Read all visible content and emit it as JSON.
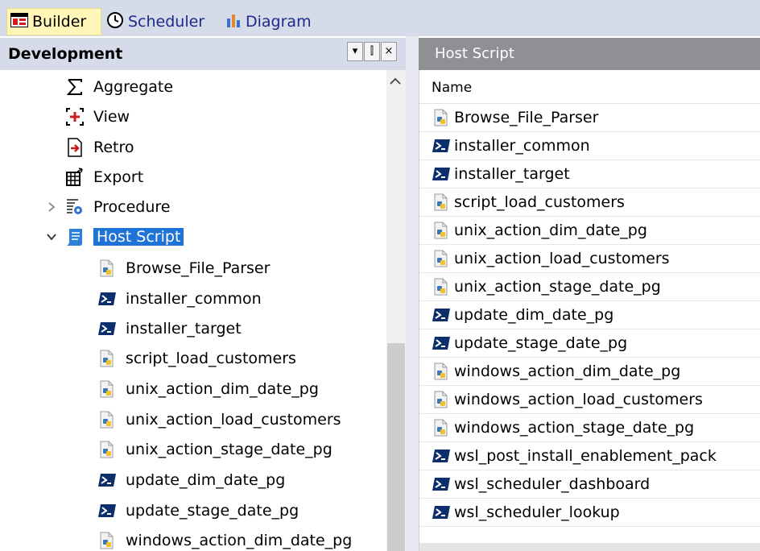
{
  "tabs": [
    {
      "label": "Builder",
      "icon": "builder-icon",
      "active": true
    },
    {
      "label": "Scheduler",
      "icon": "clock-icon",
      "active": false
    },
    {
      "label": "Diagram",
      "icon": "bar-chart-icon",
      "active": false
    }
  ],
  "left_panel": {
    "title": "Development",
    "buttons": {
      "dropdown": "▾",
      "pin": "⫿",
      "close": "×"
    },
    "tree": [
      {
        "label": "Aggregate",
        "icon": "sigma-icon"
      },
      {
        "label": "View",
        "icon": "view-plus-icon"
      },
      {
        "label": "Retro",
        "icon": "retro-icon"
      },
      {
        "label": "Export",
        "icon": "export-grid-icon"
      },
      {
        "label": "Procedure",
        "icon": "procedure-icon"
      },
      {
        "label": "Host Script",
        "icon": "scroll-icon"
      }
    ],
    "children": [
      {
        "label": "Browse_File_Parser",
        "icon": "python-script-icon"
      },
      {
        "label": "installer_common",
        "icon": "powershell-icon"
      },
      {
        "label": "installer_target",
        "icon": "powershell-icon"
      },
      {
        "label": "script_load_customers",
        "icon": "python-script-icon"
      },
      {
        "label": "unix_action_dim_date_pg",
        "icon": "python-script-icon"
      },
      {
        "label": "unix_action_load_customers",
        "icon": "python-script-icon"
      },
      {
        "label": "unix_action_stage_date_pg",
        "icon": "python-script-icon"
      },
      {
        "label": "update_dim_date_pg",
        "icon": "powershell-icon"
      },
      {
        "label": "update_stage_date_pg",
        "icon": "powershell-icon"
      },
      {
        "label": "windows_action_dim_date_pg",
        "icon": "python-script-icon"
      }
    ]
  },
  "right_panel": {
    "title": "Host Script",
    "column": "Name",
    "rows": [
      {
        "label": "Browse_File_Parser",
        "icon": "python-script-icon"
      },
      {
        "label": "installer_common",
        "icon": "powershell-icon"
      },
      {
        "label": "installer_target",
        "icon": "powershell-icon"
      },
      {
        "label": "script_load_customers",
        "icon": "python-script-icon"
      },
      {
        "label": "unix_action_dim_date_pg",
        "icon": "python-script-icon"
      },
      {
        "label": "unix_action_load_customers",
        "icon": "python-script-icon"
      },
      {
        "label": "unix_action_stage_date_pg",
        "icon": "python-script-icon"
      },
      {
        "label": "update_dim_date_pg",
        "icon": "powershell-icon"
      },
      {
        "label": "update_stage_date_pg",
        "icon": "powershell-icon"
      },
      {
        "label": "windows_action_dim_date_pg",
        "icon": "python-script-icon"
      },
      {
        "label": "windows_action_load_customers",
        "icon": "python-script-icon"
      },
      {
        "label": "windows_action_stage_date_pg",
        "icon": "python-script-icon"
      },
      {
        "label": "wsl_post_install_enablement_pack",
        "icon": "powershell-icon"
      },
      {
        "label": "wsl_scheduler_dashboard",
        "icon": "powershell-icon"
      },
      {
        "label": "wsl_scheduler_lookup",
        "icon": "powershell-icon"
      }
    ]
  },
  "colors": {
    "tab_bar": "#d6dbe9",
    "active_tab": "#fff6b8",
    "selection": "#1e73d6",
    "right_header": "#8f9094",
    "powershell": "#0c2f6b"
  }
}
